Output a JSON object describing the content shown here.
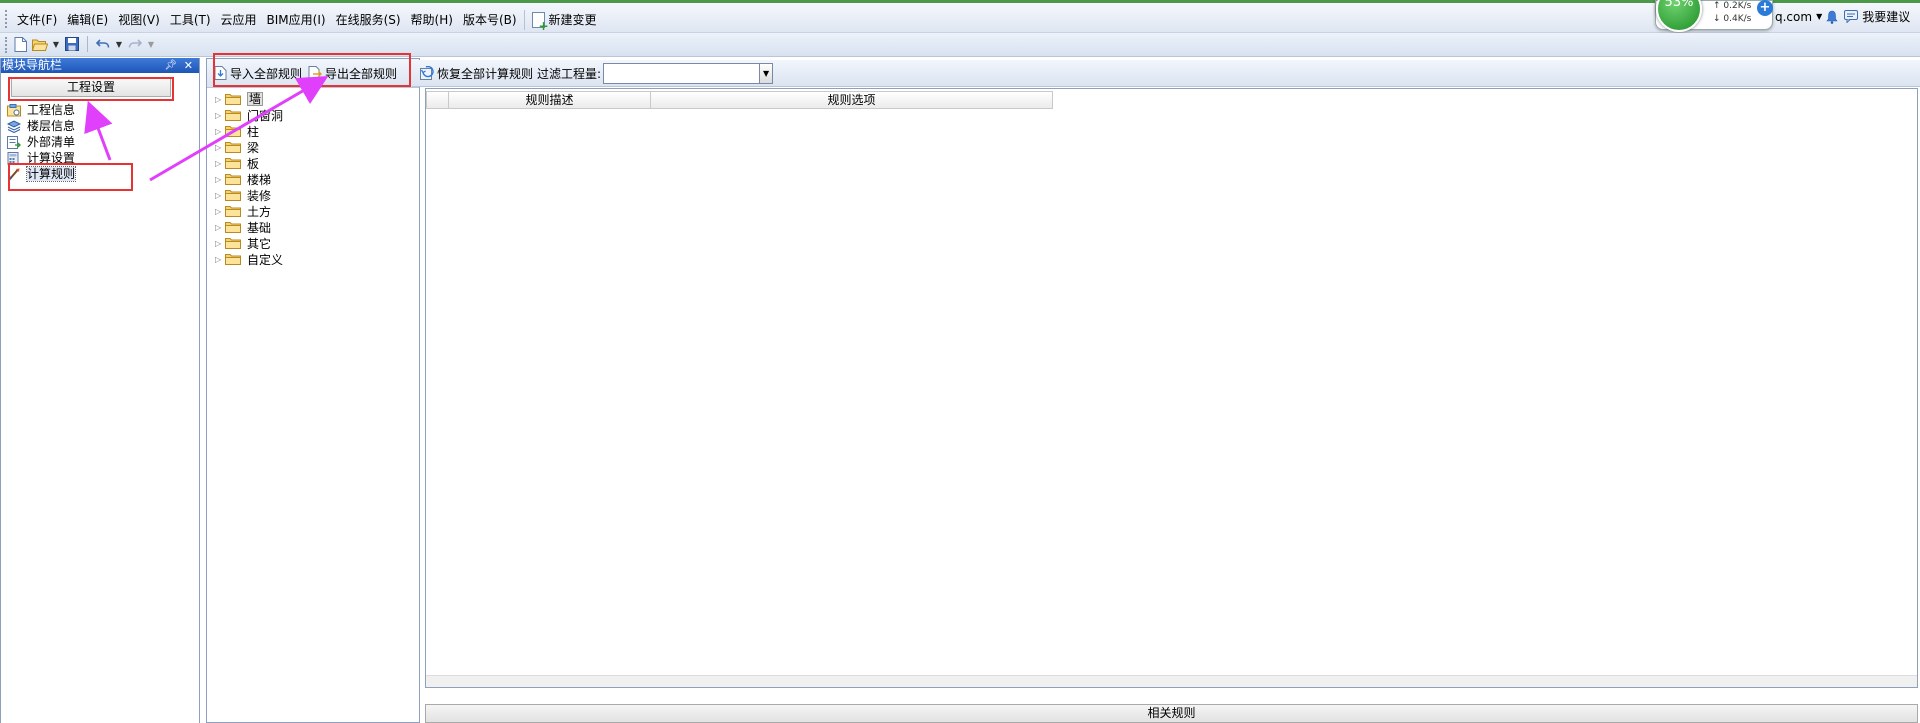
{
  "menu": {
    "items": [
      "文件(F)",
      "编辑(E)",
      "视图(V)",
      "工具(T)",
      "云应用",
      "BIM应用(I)",
      "在线服务(S)",
      "帮助(H)",
      "版本号(B)"
    ],
    "new_change": "新建变更"
  },
  "net": {
    "percent": "53%",
    "up": "0.2K/s",
    "down": "0.4K/s"
  },
  "account": {
    "domain": "q.com",
    "suggest": "我要建议"
  },
  "nav": {
    "title": "模块导航栏",
    "tab": "工程设置",
    "items": [
      {
        "label": "工程信息",
        "icon": "project-info-icon"
      },
      {
        "label": "楼层信息",
        "icon": "floor-info-icon"
      },
      {
        "label": "外部清单",
        "icon": "external-list-icon"
      },
      {
        "label": "计算设置",
        "icon": "calc-settings-icon"
      },
      {
        "label": "计算规则",
        "icon": "calc-rules-icon"
      }
    ]
  },
  "rule_toolbar": {
    "import_label": "导入全部规则",
    "export_label": "导出全部规则",
    "restore_label": "恢复全部计算规则",
    "filter_label": "过滤工程量:",
    "filter_value": ""
  },
  "tree": {
    "items": [
      "墙",
      "门窗洞",
      "柱",
      "梁",
      "板",
      "楼梯",
      "装修",
      "土方",
      "基础",
      "其它",
      "自定义"
    ]
  },
  "grid": {
    "columns": [
      "",
      "规则描述",
      "规则选项"
    ]
  },
  "related": {
    "label": "相关规则"
  },
  "colors": {
    "accent": "#1e56b7",
    "annotation_red": "#e63333",
    "annotation_arrow": "#e040fb"
  }
}
